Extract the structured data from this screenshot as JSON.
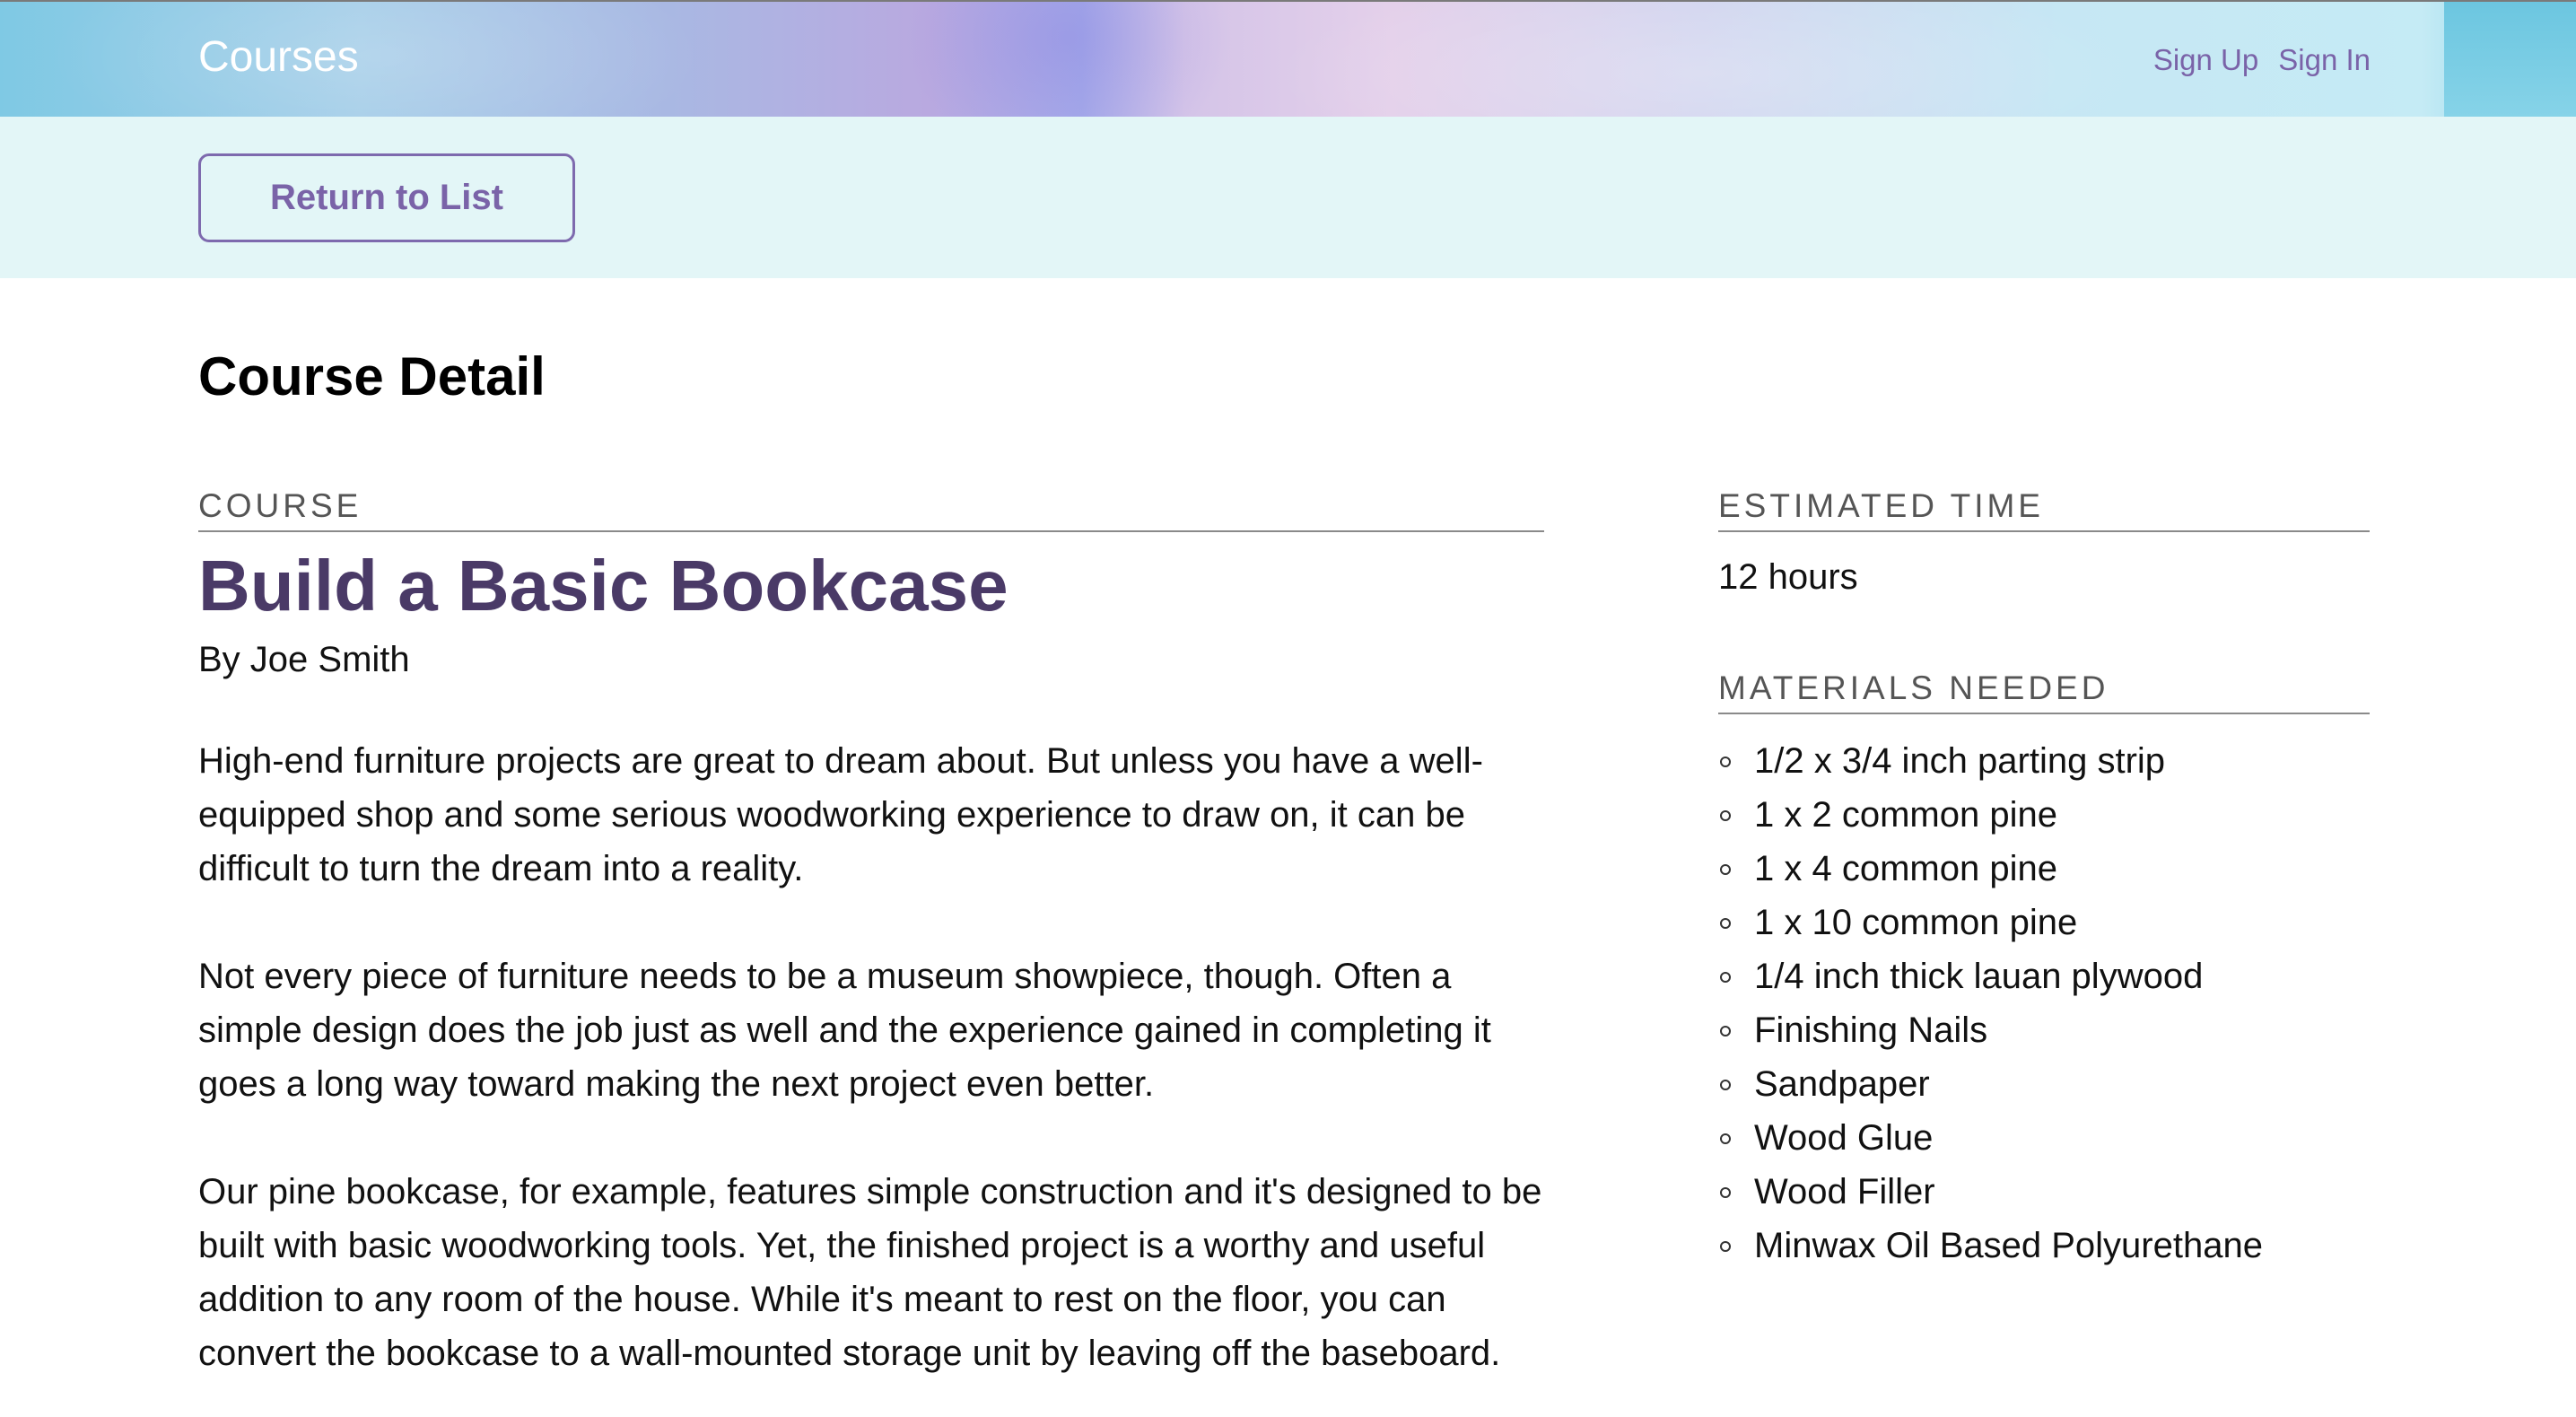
{
  "header": {
    "brand": "Courses",
    "sign_up": "Sign Up",
    "sign_in": "Sign In"
  },
  "toolbar": {
    "return_label": "Return to List"
  },
  "page": {
    "title": "Course Detail"
  },
  "course": {
    "section_label": "COURSE",
    "title": "Build a Basic Bookcase",
    "author": "By Joe Smith",
    "paragraphs": [
      "High-end furniture projects are great to dream about. But unless you have a well-equipped shop and some serious woodworking experience to draw on, it can be difficult to turn the dream into a reality.",
      "Not every piece of furniture needs to be a museum showpiece, though. Often a simple design does the job just as well and the experience gained in completing it goes a long way toward making the next project even better.",
      "Our pine bookcase, for example, features simple construction and it's designed to be built with basic woodworking tools. Yet, the finished project is a worthy and useful addition to any room of the house. While it's meant to rest on the floor, you can convert the bookcase to a wall-mounted storage unit by leaving off the baseboard."
    ]
  },
  "sidebar": {
    "estimated_time_label": "ESTIMATED TIME",
    "estimated_time_value": "12 hours",
    "materials_label": "MATERIALS NEEDED",
    "materials": [
      "1/2 x 3/4 inch parting strip",
      "1 x 2 common pine",
      "1 x 4 common pine",
      "1 x 10 common pine",
      "1/4 inch thick lauan plywood",
      "Finishing Nails",
      "Sandpaper",
      "Wood Glue",
      "Wood Filler",
      "Minwax Oil Based Polyurethane"
    ]
  }
}
